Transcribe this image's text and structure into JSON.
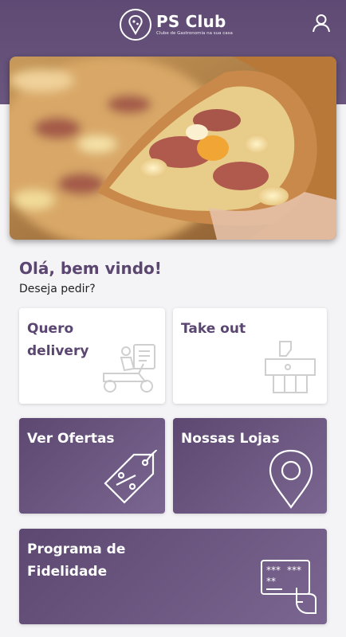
{
  "header": {
    "brand_title": "PS Club",
    "brand_subtitle": "Clube de Gastronomia na sua casa",
    "icons": {
      "logo": "pizza-slice-icon",
      "account": "user-icon"
    },
    "background_color": "#5e4a73"
  },
  "hero": {
    "alt": "pizza-slice-photo"
  },
  "greeting": {
    "title": "Olá, bem vindo!",
    "subtitle": "Deseja pedir?"
  },
  "cards": {
    "delivery": {
      "label_line1": "Quero",
      "label_line2": "delivery",
      "icon": "delivery-scooter-icon"
    },
    "takeout": {
      "label": "Take out",
      "icon": "takeout-bag-icon"
    },
    "offers": {
      "label": "Ver Ofertas",
      "icon": "discount-tag-icon"
    },
    "stores": {
      "label": "Nossas Lojas",
      "icon": "map-pin-icon"
    },
    "loyalty": {
      "label_line1": "Programa de",
      "label_line2": "Fidelidade",
      "icon": "loyalty-card-icon"
    }
  },
  "colors": {
    "accent": "#5a4670",
    "card_dark": "#6a567e",
    "card_light": "#ffffff"
  }
}
